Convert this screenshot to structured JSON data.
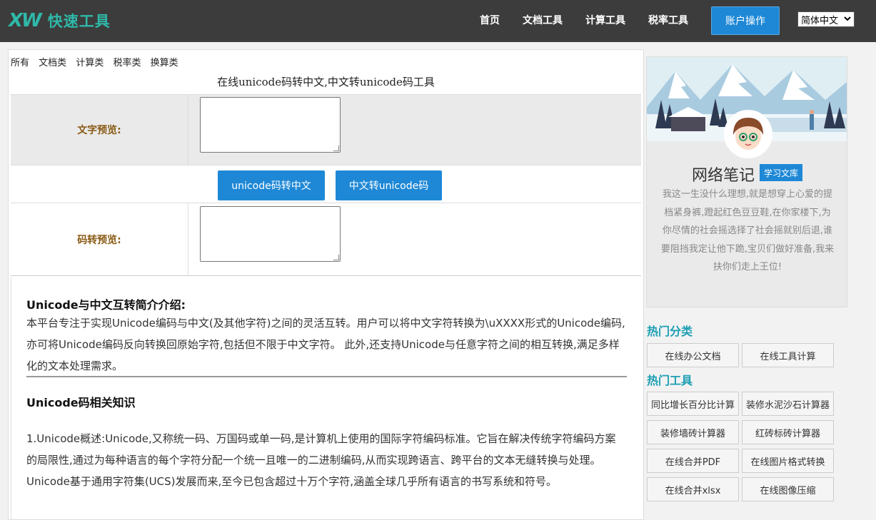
{
  "header": {
    "logo_mark": "XW",
    "logo_text": "快速工具",
    "nav": [
      {
        "label": "首页"
      },
      {
        "label": "文档工具"
      },
      {
        "label": "计算工具"
      },
      {
        "label": "税率工具"
      }
    ],
    "account_button": "账户操作",
    "language": "简体中文"
  },
  "categories": [
    "所有",
    "文档类",
    "计算类",
    "税率类",
    "换算类"
  ],
  "tool": {
    "title": "在线unicode码转中文,中文转unicode码工具",
    "text_preview_label": "文字预览:",
    "code_preview_label": "码转预览:",
    "text_preview_value": "",
    "code_preview_value": "",
    "btn_unicode_to_cn": "unicode码转中文",
    "btn_cn_to_unicode": "中文转unicode码"
  },
  "intro": {
    "heading1": "Unicode与中文互转简介介绍:",
    "para1": "本平台专注于实现Unicode编码与中文(及其他字符)之间的灵活互转。用户可以将中文字符转换为\\uXXXX形式的Unicode编码,亦可将Unicode编码反向转换回原始字符,包括但不限于中文字符。 此外,还支持Unicode与任意字符之间的相互转换,满足多样化的文本处理需求。",
    "heading2": "Unicode码相关知识",
    "para2": "1.Unicode概述:Unicode,又称统一码、万国码或单一码,是计算机上使用的国际字符编码标准。它旨在解决传统字符编码方案的局限性,通过为每种语言的每个字符分配一个统一且唯一的二进制编码,从而实现跨语言、跨平台的文本无缝转换与处理。Unicode基于通用字符集(UCS)发展而来,至今已包含超过十万个字符,涵盖全球几乎所有语言的书写系统和符号。"
  },
  "profile": {
    "name": "网络笔记",
    "tag": "学习文库",
    "description": "我这一生没什么理想,就是想穿上心爱的提档紧身裤,蹬起红色豆豆鞋,在你家楼下,为你尽情的社会摇选择了社会摇就别后退,谁要阻挡我定让他下跪,宝贝们做好准备,我来扶你们走上王位!"
  },
  "sidebar": {
    "hot_categories_title": "热门分类",
    "hot_categories": [
      "在线办公文档",
      "在线工具计算"
    ],
    "hot_tools_title": "热门工具",
    "hot_tools": [
      "同比增长百分比计算",
      "装修水泥沙石计算器",
      "装修墙砖计算器",
      "红砖标砖计算器",
      "在线合并PDF",
      "在线图片格式转换",
      "在线合并xlsx",
      "在线图像压缩"
    ]
  },
  "colors": {
    "header_bg": "#3c3c3c",
    "accent": "#1e88d6",
    "logo": "#2fb8a8",
    "label": "#8a5a14",
    "section_title": "#1b9eb4"
  }
}
